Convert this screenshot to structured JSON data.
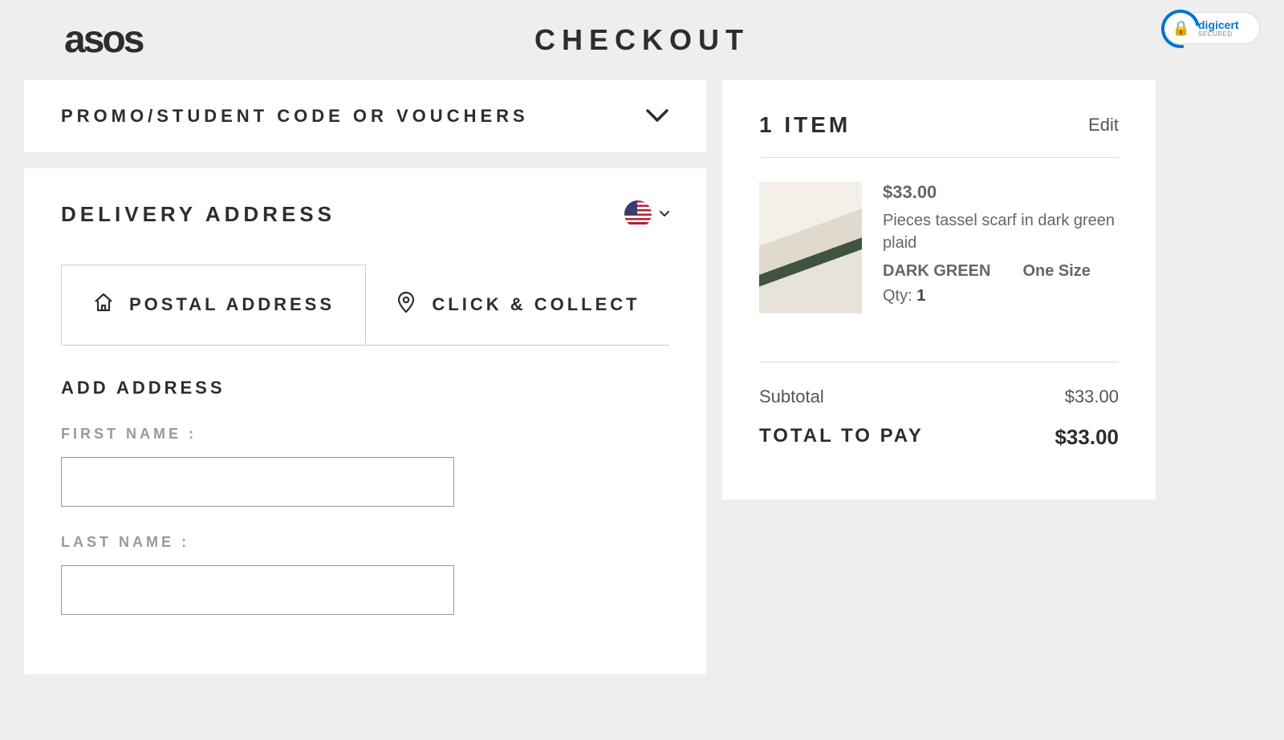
{
  "header": {
    "logo": "asos",
    "title": "CHECKOUT",
    "badge": {
      "brand": "digicert",
      "sub": "SECURED"
    }
  },
  "promo": {
    "title": "PROMO/STUDENT CODE OR VOUCHERS"
  },
  "delivery": {
    "title": "DELIVERY ADDRESS",
    "country": "United States",
    "tabs": {
      "postal": "POSTAL ADDRESS",
      "click_collect": "CLICK & COLLECT"
    },
    "add_address": "ADD ADDRESS",
    "fields": {
      "first_name_label": "FIRST NAME :",
      "first_name_value": "",
      "last_name_label": "LAST NAME :",
      "last_name_value": ""
    }
  },
  "summary": {
    "count_label": "1 ITEM",
    "edit": "Edit",
    "item": {
      "price": "$33.00",
      "name": "Pieces tassel scarf in dark green plaid",
      "color": "DARK GREEN",
      "size": "One Size",
      "qty_label": "Qty: ",
      "qty": "1"
    },
    "subtotal_label": "Subtotal",
    "subtotal_value": "$33.00",
    "total_label": "TOTAL TO PAY",
    "total_value": "$33.00"
  }
}
